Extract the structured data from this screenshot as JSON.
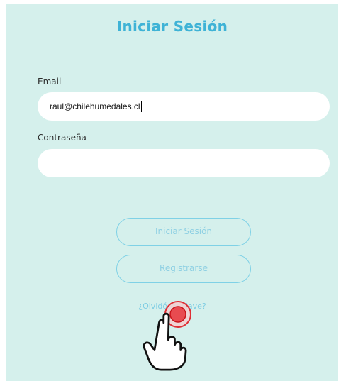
{
  "login": {
    "title": "Iniciar Sesión",
    "email_label": "Email",
    "email_value": "raul@chilehumedales.cl",
    "password_label": "Contraseña",
    "password_value": "",
    "login_button": "Iniciar Sesión",
    "register_button": "Registrarse",
    "forgot_link": "¿Olvidó su clave?"
  },
  "colors": {
    "background": "#d5f0ec",
    "title": "#3fb3d6",
    "button_border": "#7fd1e6",
    "button_text": "#8fd0e3",
    "tap_marker": "#e11b22"
  },
  "overlay": {
    "icon": "tap-hand-icon"
  }
}
